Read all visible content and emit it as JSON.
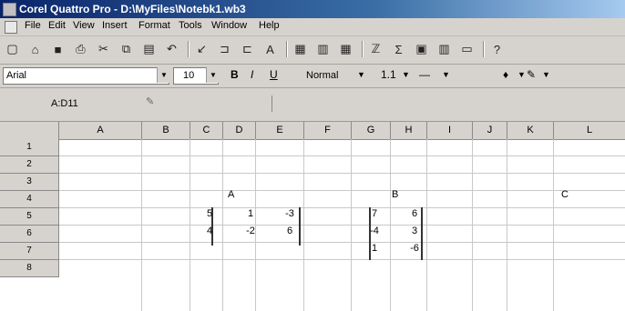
{
  "window": {
    "title": "Corel Quattro Pro - D:\\MyFiles\\Notebk1.wb3"
  },
  "menu": [
    "File",
    "Edit",
    "View",
    "Insert",
    "Format",
    "Tools",
    "Window",
    "Help"
  ],
  "toolbar": {
    "icons": [
      "new-icon",
      "open-icon",
      "save-icon",
      "print-icon",
      "cut-icon",
      "copy-icon",
      "paste-icon",
      "undo-icon",
      "sep",
      "align-icon",
      "insert-row-icon",
      "insert-col-icon",
      "text-box-icon",
      "sep",
      "chart-icon",
      "grid-icon",
      "grid2-icon",
      "sep",
      "sort-icon",
      "sum-icon",
      "chart2-icon",
      "map-icon",
      "table-icon",
      "sep",
      "help-icon"
    ],
    "glyphs": [
      "▢",
      "⌂",
      "■",
      "⎙",
      "✂",
      "⧉",
      "▤",
      "↶",
      "",
      "↙",
      "⊐",
      "⊏",
      "A",
      "",
      "▦",
      "▥",
      "▦",
      "",
      "ℤ",
      "Σ",
      "▣",
      "▥",
      "▭",
      "",
      "?"
    ]
  },
  "format_toolbar": {
    "font": "Arial",
    "size": "10",
    "bold": "B",
    "italic": "I",
    "underline": "U",
    "style": "Normal",
    "general": "1.1"
  },
  "input_line": {
    "cell_ref": "A:D11",
    "formula": ""
  },
  "columns": [
    "A",
    "B",
    "C",
    "D",
    "E",
    "F",
    "G",
    "H",
    "I",
    "J",
    "K",
    "L"
  ],
  "rows": [
    "1",
    "2",
    "3",
    "4",
    "5",
    "6",
    "7",
    "8"
  ],
  "matrix_labels": {
    "A": "A",
    "B": "B",
    "C": "C"
  },
  "matrix_a": [
    [
      "5",
      "1",
      "-3"
    ],
    [
      "4",
      "-2",
      "6"
    ]
  ],
  "matrix_b": [
    [
      "7",
      "6"
    ],
    [
      "-4",
      "3"
    ],
    [
      "1",
      "-6"
    ]
  ]
}
